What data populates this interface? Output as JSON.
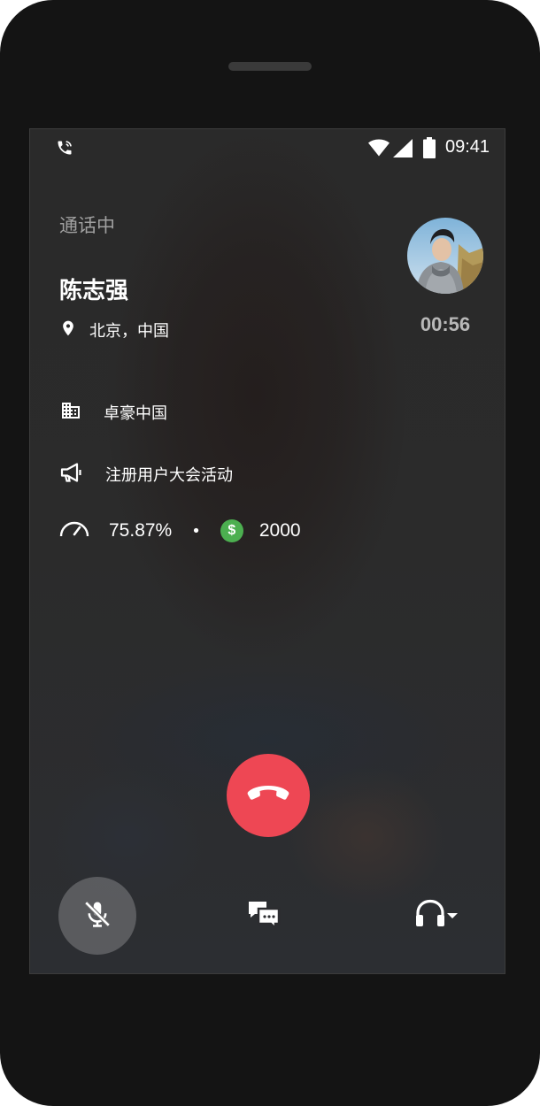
{
  "status_bar": {
    "time": "09:41",
    "icons": [
      "call-status-icon",
      "wifi-icon",
      "signal-icon",
      "battery-icon"
    ]
  },
  "call": {
    "state": "通话中",
    "contact_name": "陈志强",
    "location": "北京，中国",
    "company": "卓豪中国",
    "campaign": "注册用户大会活动",
    "score_percent": "75.87%",
    "separator": "•",
    "amount": "2000",
    "duration": "00:56"
  },
  "icons": {
    "location": "location-pin-icon",
    "company": "building-icon",
    "campaign": "megaphone-icon",
    "score": "gauge-icon",
    "amount": "dollar-icon",
    "money_symbol": "$"
  },
  "controls": {
    "hangup": "hang-up-icon",
    "mute": "mic-off-icon",
    "message": "chat-icon",
    "audio": "headset-icon"
  },
  "colors": {
    "hangup": "#ee4754",
    "money": "#4caf50",
    "timer": "#b8b8b8",
    "state_text": "#a0a0a0"
  }
}
